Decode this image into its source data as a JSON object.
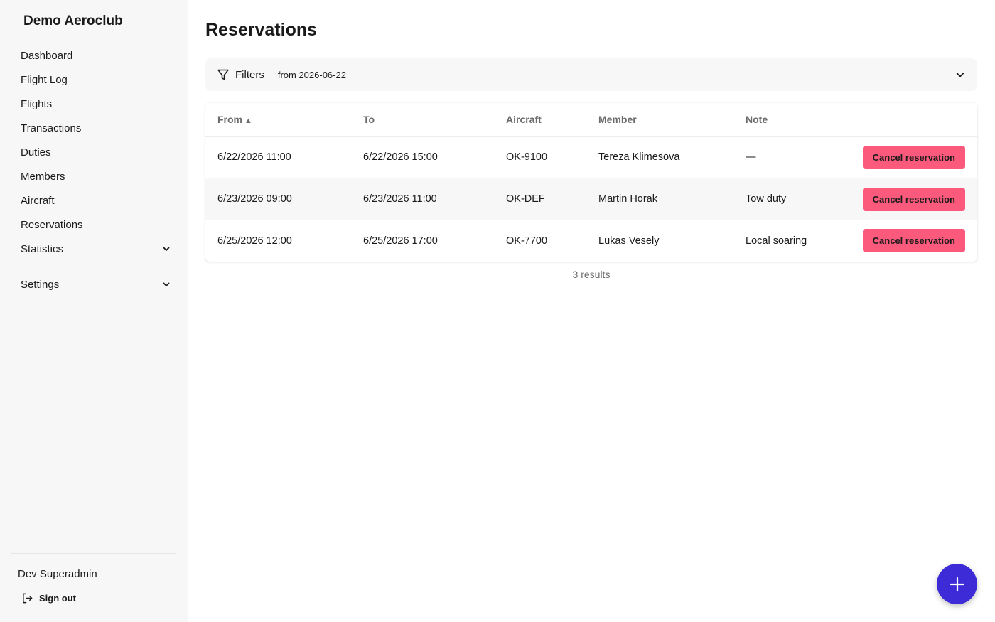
{
  "app": {
    "name": "Demo Aeroclub"
  },
  "sidebar": {
    "items": [
      {
        "label": "Dashboard"
      },
      {
        "label": "Flight Log"
      },
      {
        "label": "Flights"
      },
      {
        "label": "Transactions"
      },
      {
        "label": "Duties"
      },
      {
        "label": "Members"
      },
      {
        "label": "Aircraft"
      },
      {
        "label": "Reservations"
      },
      {
        "label": "Statistics"
      },
      {
        "label": "Settings"
      }
    ],
    "user": "Dev Superadmin",
    "signout_label": "Sign out"
  },
  "page": {
    "title": "Reservations"
  },
  "filters": {
    "label": "Filters",
    "active": "from 2026-06-22"
  },
  "table": {
    "headers": {
      "from": "From",
      "to": "To",
      "aircraft": "Aircraft",
      "member": "Member",
      "note": "Note"
    },
    "sort_indicator": "▲",
    "rows": [
      {
        "from": "6/22/2026 11:00",
        "to": "6/22/2026 15:00",
        "aircraft": "OK-9100",
        "member": "Tereza Klimesova",
        "note": "—",
        "action": "Cancel reservation"
      },
      {
        "from": "6/23/2026 09:00",
        "to": "6/23/2026 11:00",
        "aircraft": "OK-DEF",
        "member": "Martin Horak",
        "note": "Tow duty",
        "action": "Cancel reservation"
      },
      {
        "from": "6/25/2026 12:00",
        "to": "6/25/2026 17:00",
        "aircraft": "OK-7700",
        "member": "Lukas Vesely",
        "note": "Local soaring",
        "action": "Cancel reservation"
      }
    ],
    "results_text": "3 results"
  },
  "colors": {
    "accent": "#3c2bd6",
    "danger": "#fb5a7c",
    "sidebar_bg": "#f7f7f7"
  },
  "icons": {
    "filter": "funnel-icon",
    "expand": "chevron-down-icon",
    "signout": "sign-out-icon",
    "add": "plus-icon"
  }
}
